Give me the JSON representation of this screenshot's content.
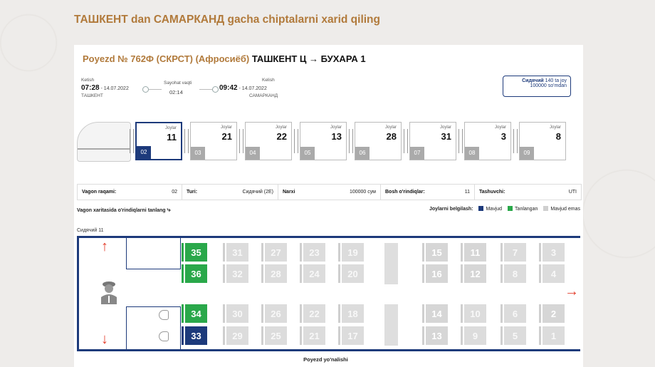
{
  "page": {
    "title": "ТАШКЕНТ dan САМАРКАНД gacha chiptalarni xarid qiling"
  },
  "train": {
    "number_label": "Poyezd № 762Ф (СКРСТ) (Афросиёб)",
    "route": "ТАШКЕНТ Ц → БУХАРА 1"
  },
  "timeline": {
    "depart_label": "Ketish",
    "depart_time": "07:28",
    "depart_date": "- 14.07.2022",
    "depart_station": "ТАШКЕНТ",
    "duration_label": "Sayohat vaqti",
    "duration": "02:14",
    "arrive_label": "Kelish",
    "arrive_time": "09:42",
    "arrive_date": "- 14.07.2022",
    "arrive_station": "САМАРКАНД"
  },
  "price_box": {
    "line1_bold": "Сидячий",
    "line1_rest": "140 ta joy",
    "line2": "100000 so'mdan"
  },
  "wagons": [
    {
      "num": "02",
      "label": "Joylar",
      "count": "11",
      "selected": true
    },
    {
      "num": "03",
      "label": "Joylar",
      "count": "21",
      "selected": false
    },
    {
      "num": "04",
      "label": "Joylar",
      "count": "22",
      "selected": false
    },
    {
      "num": "05",
      "label": "Joylar",
      "count": "13",
      "selected": false
    },
    {
      "num": "06",
      "label": "Joylar",
      "count": "28",
      "selected": false
    },
    {
      "num": "07",
      "label": "Joylar",
      "count": "31",
      "selected": false
    },
    {
      "num": "08",
      "label": "Joylar",
      "count": "3",
      "selected": false
    },
    {
      "num": "09",
      "label": "Joylar",
      "count": "8",
      "selected": false
    }
  ],
  "info": {
    "wagon_label": "Vagon raqami:",
    "wagon_value": "02",
    "type_label": "Turi:",
    "type_value": "Сидячий (2Е)",
    "price_label": "Narxi",
    "price_value": "100000 сум",
    "free_label": "Bosh o'rindiqlar:",
    "free_value": "11",
    "carrier_label": "Tashuvchi:",
    "carrier_value": "UTI"
  },
  "hint": "Vagon xaritasida o'rindiqlarni tanlang",
  "legend": {
    "title": "Joylarni belgilash:",
    "available": "Mavjud",
    "selected": "Tanlangan",
    "unavailable": "Mavjud emas",
    "colors": {
      "available": "#1d3a7b",
      "selected": "#2aa84a",
      "unavailable": "#cfcfcf"
    }
  },
  "car_label": "Сидячий 11",
  "seats": [
    {
      "n": "35",
      "state": "sel"
    },
    {
      "n": "36",
      "state": "sel"
    },
    {
      "n": "34",
      "state": "sel"
    },
    {
      "n": "33",
      "state": "free"
    },
    {
      "n": "31",
      "state": "na"
    },
    {
      "n": "32",
      "state": "na"
    },
    {
      "n": "30",
      "state": "na"
    },
    {
      "n": "29",
      "state": "na"
    },
    {
      "n": "27",
      "state": "na"
    },
    {
      "n": "28",
      "state": "na"
    },
    {
      "n": "26",
      "state": "na"
    },
    {
      "n": "25",
      "state": "na"
    },
    {
      "n": "23",
      "state": "na"
    },
    {
      "n": "24",
      "state": "na"
    },
    {
      "n": "22",
      "state": "na"
    },
    {
      "n": "21",
      "state": "na"
    },
    {
      "n": "19",
      "state": "na"
    },
    {
      "n": "20",
      "state": "na"
    },
    {
      "n": "18",
      "state": "na"
    },
    {
      "n": "17",
      "state": "na"
    },
    {
      "n": "15",
      "state": "gray"
    },
    {
      "n": "16",
      "state": "gray"
    },
    {
      "n": "14",
      "state": "gray"
    },
    {
      "n": "13",
      "state": "gray"
    },
    {
      "n": "11",
      "state": "gray"
    },
    {
      "n": "12",
      "state": "gray"
    },
    {
      "n": "10",
      "state": "na"
    },
    {
      "n": "9",
      "state": "na"
    },
    {
      "n": "7",
      "state": "na"
    },
    {
      "n": "8",
      "state": "na"
    },
    {
      "n": "6",
      "state": "na"
    },
    {
      "n": "5",
      "state": "na"
    },
    {
      "n": "3",
      "state": "na"
    },
    {
      "n": "4",
      "state": "na"
    },
    {
      "n": "2",
      "state": "gray"
    },
    {
      "n": "1",
      "state": "na"
    }
  ],
  "direction": "Poyezd yo'nalishi"
}
